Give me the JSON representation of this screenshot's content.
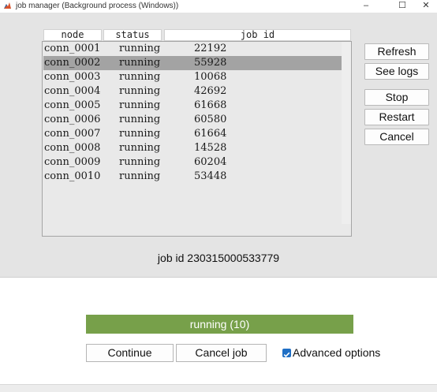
{
  "window": {
    "title": "job manager (Background process (Windows))",
    "minimize_glyph": "–",
    "maximize_glyph": "☐",
    "close_glyph": "✕"
  },
  "table": {
    "headers": [
      "node",
      "status",
      "job id"
    ],
    "selected_row": 1,
    "rows": [
      {
        "node": "conn_0001",
        "status": "running",
        "job_id": "22192"
      },
      {
        "node": "conn_0002",
        "status": "running",
        "job_id": "55928"
      },
      {
        "node": "conn_0003",
        "status": "running",
        "job_id": "10068"
      },
      {
        "node": "conn_0004",
        "status": "running",
        "job_id": "42692"
      },
      {
        "node": "conn_0005",
        "status": "running",
        "job_id": "61668"
      },
      {
        "node": "conn_0006",
        "status": "running",
        "job_id": "60580"
      },
      {
        "node": "conn_0007",
        "status": "running",
        "job_id": "61664"
      },
      {
        "node": "conn_0008",
        "status": "running",
        "job_id": "14528"
      },
      {
        "node": "conn_0009",
        "status": "running",
        "job_id": "60204"
      },
      {
        "node": "conn_0010",
        "status": "running",
        "job_id": "53448"
      }
    ]
  },
  "side_buttons": {
    "refresh": "Refresh",
    "see_logs": "See logs",
    "stop": "Stop",
    "restart": "Restart",
    "cancel": "Cancel"
  },
  "job_id_label": "job id 230315000533779",
  "progress": {
    "label": "running (10)",
    "fraction": 1.0,
    "color": "#77a04a"
  },
  "bottom": {
    "continue": "Continue",
    "cancel_job": "Cancel job",
    "advanced_options": "Advanced options",
    "advanced_checked": true
  },
  "colors": {
    "panel": "#e4e4e4",
    "selection": "#a3a3a3",
    "checkbox": "#1f6fc5"
  }
}
